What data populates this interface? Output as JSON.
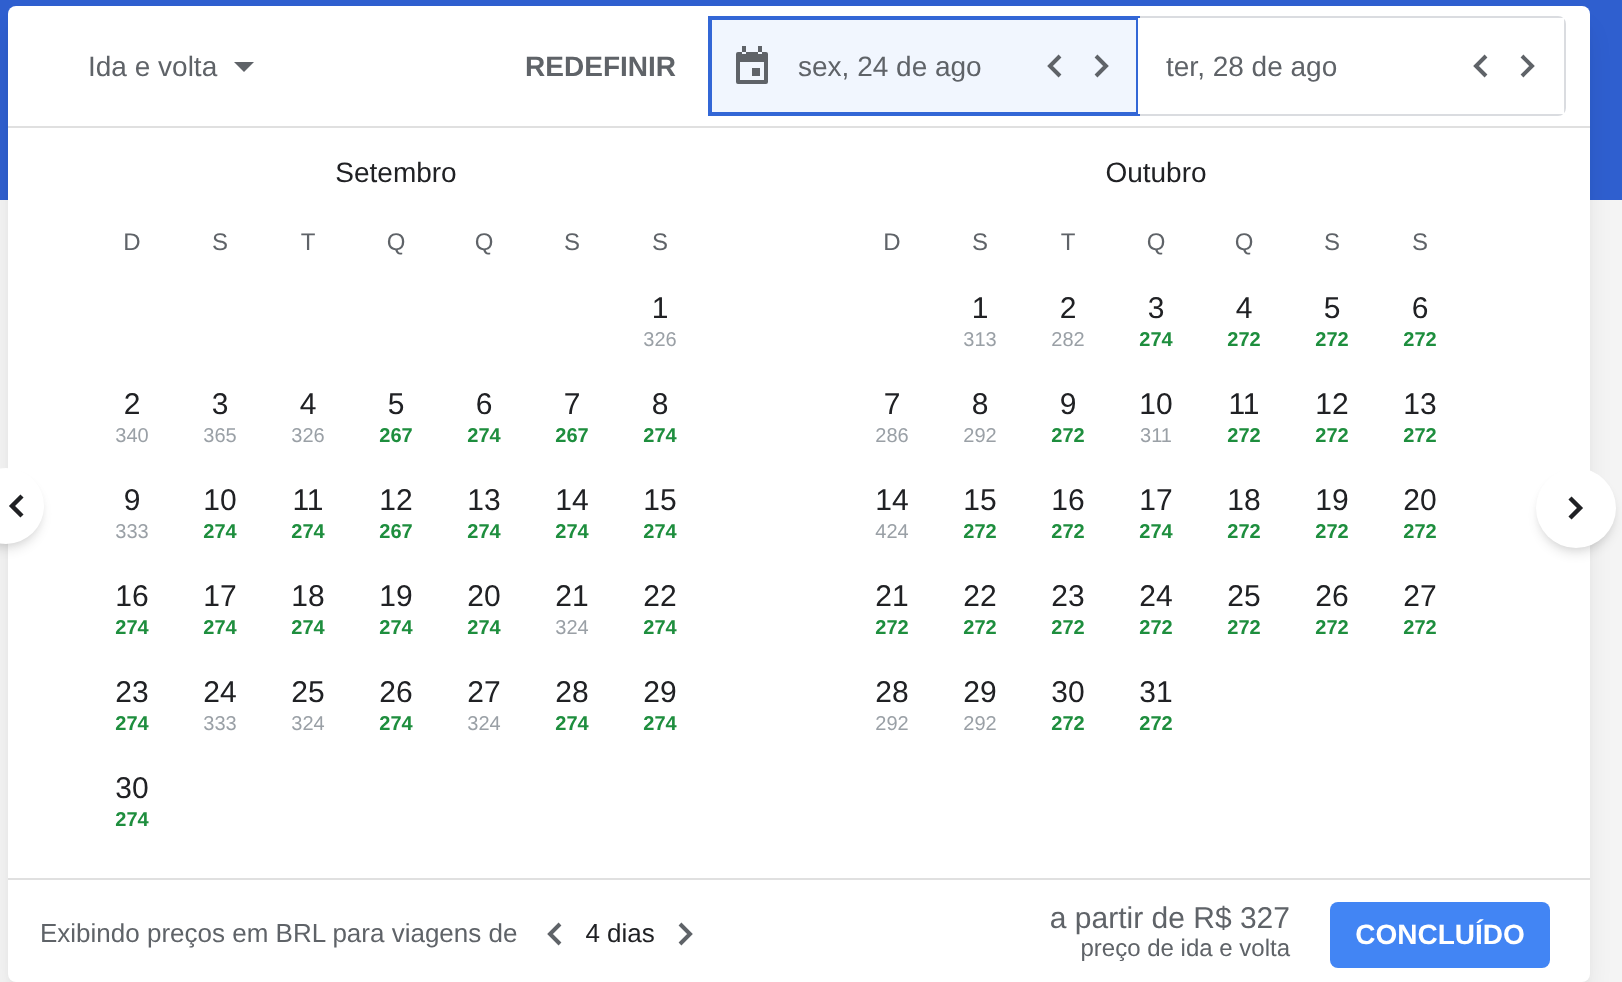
{
  "header": {
    "trip_type": "Ida e volta",
    "reset_button": "REDEFINIR",
    "date_fields": [
      {
        "value": "sex, 24 de ago",
        "selected": true
      },
      {
        "value": "ter, 28 de ago",
        "selected": false
      }
    ]
  },
  "months": [
    {
      "title": "Setembro",
      "weekdays": [
        "D",
        "S",
        "T",
        "Q",
        "Q",
        "S",
        "S"
      ],
      "weeks": [
        {
          "right_aligned": true,
          "days": [
            {
              "day": "1",
              "price": "326",
              "low": false
            }
          ]
        },
        {
          "right_aligned": false,
          "days": [
            {
              "day": "2",
              "price": "340",
              "low": false
            },
            {
              "day": "3",
              "price": "365",
              "low": false
            },
            {
              "day": "4",
              "price": "326",
              "low": false
            },
            {
              "day": "5",
              "price": "267",
              "low": true
            },
            {
              "day": "6",
              "price": "274",
              "low": true
            },
            {
              "day": "7",
              "price": "267",
              "low": true
            },
            {
              "day": "8",
              "price": "274",
              "low": true
            }
          ]
        },
        {
          "right_aligned": false,
          "days": [
            {
              "day": "9",
              "price": "333",
              "low": false
            },
            {
              "day": "10",
              "price": "274",
              "low": true
            },
            {
              "day": "11",
              "price": "274",
              "low": true
            },
            {
              "day": "12",
              "price": "267",
              "low": true
            },
            {
              "day": "13",
              "price": "274",
              "low": true
            },
            {
              "day": "14",
              "price": "274",
              "low": true
            },
            {
              "day": "15",
              "price": "274",
              "low": true
            }
          ]
        },
        {
          "right_aligned": false,
          "days": [
            {
              "day": "16",
              "price": "274",
              "low": true
            },
            {
              "day": "17",
              "price": "274",
              "low": true
            },
            {
              "day": "18",
              "price": "274",
              "low": true
            },
            {
              "day": "19",
              "price": "274",
              "low": true
            },
            {
              "day": "20",
              "price": "274",
              "low": true
            },
            {
              "day": "21",
              "price": "324",
              "low": false
            },
            {
              "day": "22",
              "price": "274",
              "low": true
            }
          ]
        },
        {
          "right_aligned": false,
          "days": [
            {
              "day": "23",
              "price": "274",
              "low": true
            },
            {
              "day": "24",
              "price": "333",
              "low": false
            },
            {
              "day": "25",
              "price": "324",
              "low": false
            },
            {
              "day": "26",
              "price": "274",
              "low": true
            },
            {
              "day": "27",
              "price": "324",
              "low": false
            },
            {
              "day": "28",
              "price": "274",
              "low": true
            },
            {
              "day": "29",
              "price": "274",
              "low": true
            }
          ]
        },
        {
          "right_aligned": false,
          "days": [
            {
              "day": "30",
              "price": "274",
              "low": true
            }
          ]
        }
      ]
    },
    {
      "title": "Outubro",
      "weekdays": [
        "D",
        "S",
        "T",
        "Q",
        "Q",
        "S",
        "S"
      ],
      "weeks": [
        {
          "right_aligned": true,
          "days": [
            {
              "day": "1",
              "price": "313",
              "low": false
            },
            {
              "day": "2",
              "price": "282",
              "low": false
            },
            {
              "day": "3",
              "price": "274",
              "low": true
            },
            {
              "day": "4",
              "price": "272",
              "low": true
            },
            {
              "day": "5",
              "price": "272",
              "low": true
            },
            {
              "day": "6",
              "price": "272",
              "low": true
            }
          ]
        },
        {
          "right_aligned": false,
          "days": [
            {
              "day": "7",
              "price": "286",
              "low": false
            },
            {
              "day": "8",
              "price": "292",
              "low": false
            },
            {
              "day": "9",
              "price": "272",
              "low": true
            },
            {
              "day": "10",
              "price": "311",
              "low": false
            },
            {
              "day": "11",
              "price": "272",
              "low": true
            },
            {
              "day": "12",
              "price": "272",
              "low": true
            },
            {
              "day": "13",
              "price": "272",
              "low": true
            }
          ]
        },
        {
          "right_aligned": false,
          "days": [
            {
              "day": "14",
              "price": "424",
              "low": false
            },
            {
              "day": "15",
              "price": "272",
              "low": true
            },
            {
              "day": "16",
              "price": "272",
              "low": true
            },
            {
              "day": "17",
              "price": "274",
              "low": true
            },
            {
              "day": "18",
              "price": "272",
              "low": true
            },
            {
              "day": "19",
              "price": "272",
              "low": true
            },
            {
              "day": "20",
              "price": "272",
              "low": true
            }
          ]
        },
        {
          "right_aligned": false,
          "days": [
            {
              "day": "21",
              "price": "272",
              "low": true
            },
            {
              "day": "22",
              "price": "272",
              "low": true
            },
            {
              "day": "23",
              "price": "272",
              "low": true
            },
            {
              "day": "24",
              "price": "272",
              "low": true
            },
            {
              "day": "25",
              "price": "272",
              "low": true
            },
            {
              "day": "26",
              "price": "272",
              "low": true
            },
            {
              "day": "27",
              "price": "272",
              "low": true
            }
          ]
        },
        {
          "right_aligned": false,
          "days": [
            {
              "day": "28",
              "price": "292",
              "low": false
            },
            {
              "day": "29",
              "price": "292",
              "low": false
            },
            {
              "day": "30",
              "price": "272",
              "low": true
            },
            {
              "day": "31",
              "price": "272",
              "low": true
            }
          ]
        }
      ]
    }
  ],
  "footer": {
    "note": "Exibindo preços em BRL para viagens de",
    "duration": "4 dias",
    "price": "a partir de R$ 327",
    "price_note": "preço de ida e volta",
    "done_button": "CONCLUÍDO"
  }
}
